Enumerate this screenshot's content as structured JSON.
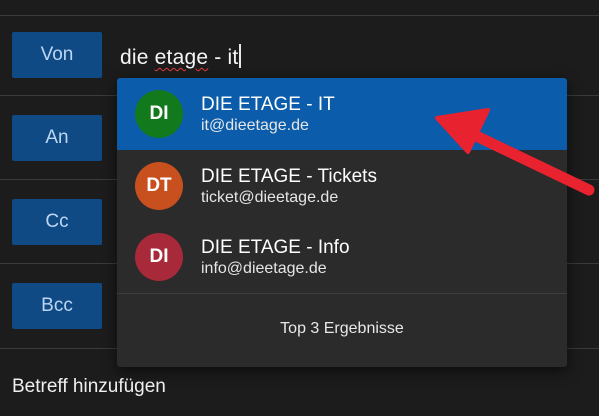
{
  "fields": {
    "from_label": "Von",
    "to_label": "An",
    "cc_label": "Cc",
    "bcc_label": "Bcc"
  },
  "to_input": {
    "value_plain": "die ",
    "value_misspelled": "etage",
    "value_rest": " - it"
  },
  "suggestions": [
    {
      "initials": "DI",
      "name": "DIE ETAGE - IT",
      "email": "it@dieetage.de",
      "avatar_color": "#127a1c",
      "selected": true
    },
    {
      "initials": "DT",
      "name": "DIE ETAGE - Tickets",
      "email": "ticket@dieetage.de",
      "avatar_color": "#c8501f",
      "selected": false
    },
    {
      "initials": "DI",
      "name": "DIE ETAGE - Info",
      "email": "info@dieetage.de",
      "avatar_color": "#a8293a",
      "selected": false
    }
  ],
  "suggestions_footer": "Top 3 Ergebnisse",
  "subject_placeholder": "Betreff hinzufügen",
  "colors": {
    "selected_row": "#0b5cab",
    "field_button": "#0f4a85",
    "annotation_arrow": "#e8222e"
  },
  "annotation": {
    "icon": "red-arrow-icon"
  }
}
